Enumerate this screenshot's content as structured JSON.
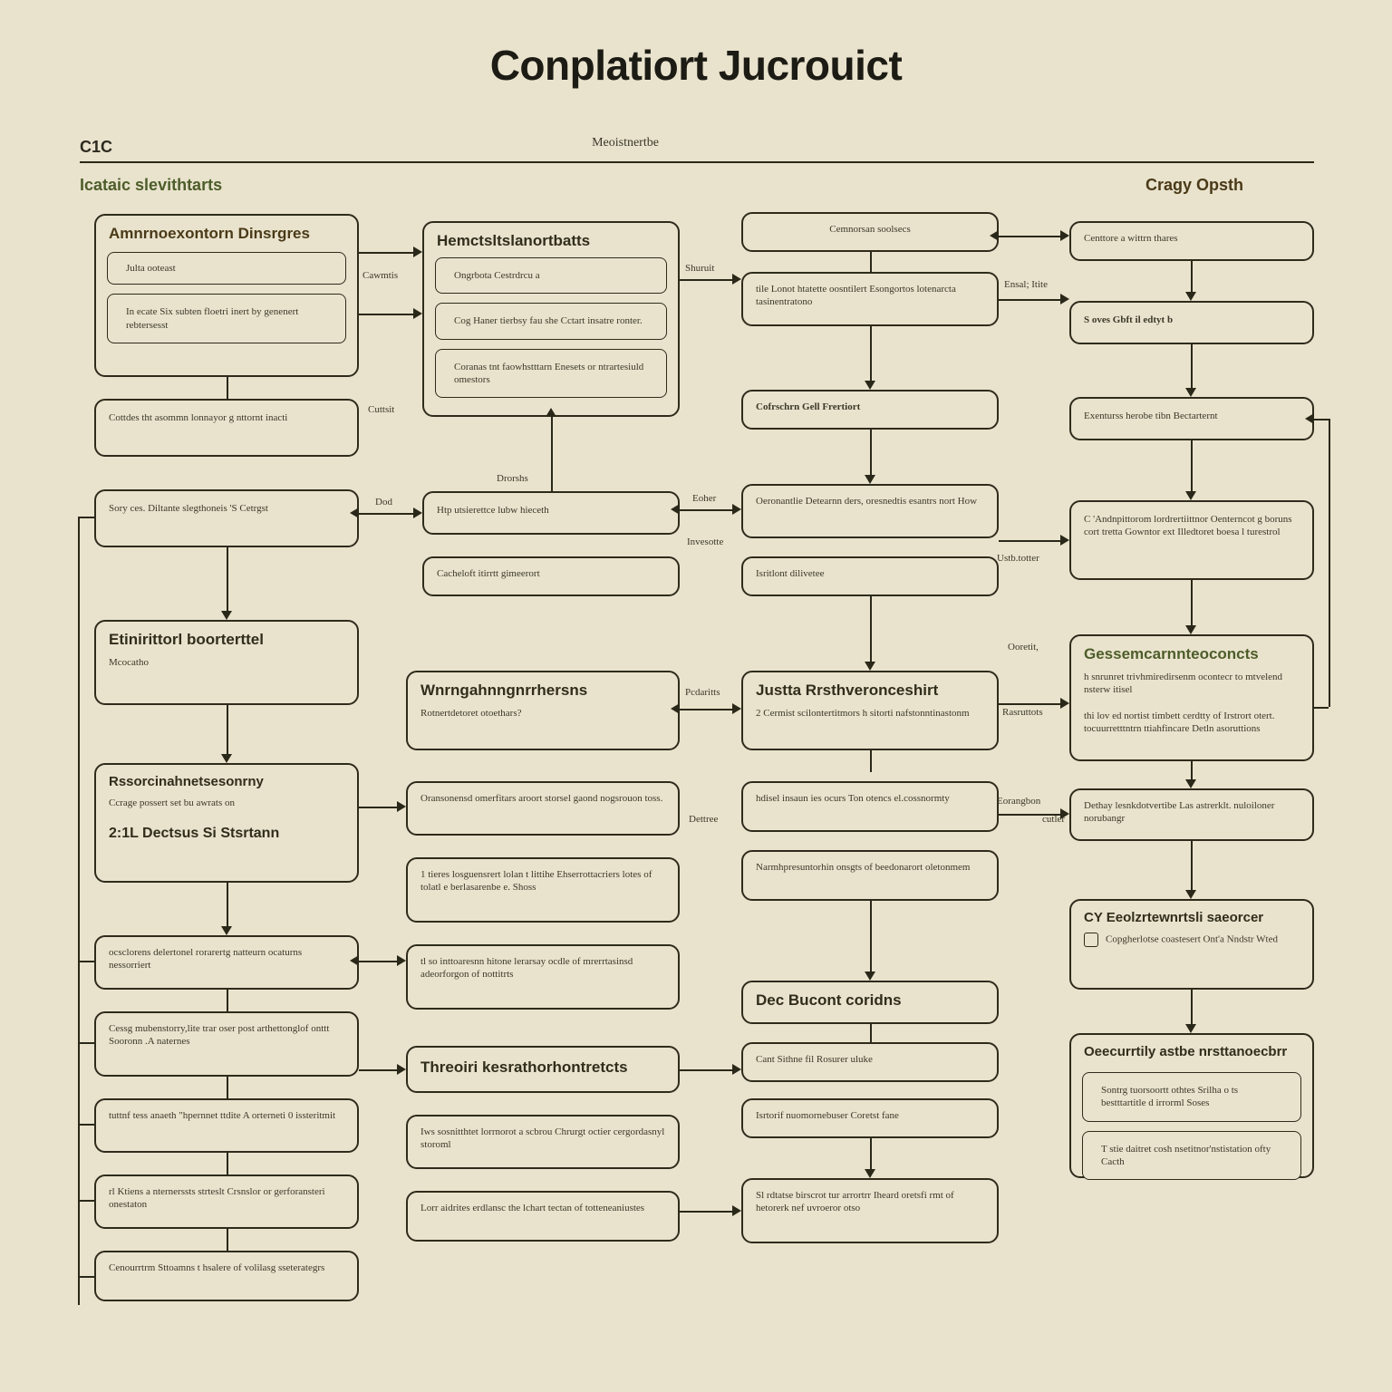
{
  "title": "Conplatiort Jucrouict",
  "top": {
    "cic": "C1C",
    "mid": "Meoistnertbe"
  },
  "section_headings": {
    "left": "Icataic slevithtarts",
    "right": "Cragy Opsth"
  },
  "col1": {
    "box1": {
      "title": "Amnrnoexontorn Dinsrgres",
      "sub": "Julta ooteast",
      "line1": "In ecate Six subten floetri inert by genenert rebtersesst"
    },
    "box2": "Cottdes tht asommn lonnayor g nttornt inacti",
    "box3": "Sory ces.  Diltante slegthoneis 'S Cetrgst",
    "box4": {
      "title": "Etinirittorl boorterttel",
      "sub": "Mcocatho"
    },
    "box5": {
      "title": "Rssorcinahnetsesonrny",
      "sub": "Ccrage possert set bu awrats on",
      "title2": "2:1L Dectsus Si Stsrtann"
    },
    "stack": [
      "ocsclorens delertonel rorarertg natteurn ocaturns nessorriert",
      "Cessg mubenstorry,lite trar oser post arthettonglof onttt Sooronn .A naternes",
      "tuttnf tess anaeth \"hpernnet ttdite A orterneti 0 issteritmit",
      "rl Ktiens a nternerssts strteslt Crsnslor or gerforansteri onestaton",
      "Cenourrtrm Sttoamns t hsalere of volilasg sseterategrs"
    ]
  },
  "col2": {
    "box1": {
      "title": "Hemctsltslanortbatts",
      "l1": "Ongrbota Cestrdrcu a",
      "l2": "Cog Haner tierbsy fau she Cctart insatre ronter.",
      "l3": "Coranas tnt faowhstttarn Enesets or ntrartesiuld omestors"
    },
    "smallTop": "Drorshs",
    "box2": "Htp utsierettce lubw hieceth",
    "box3": "Cacheloft itirrtt gimeerort",
    "box4": {
      "title": "Wnrngahnngnrrhersns",
      "sub": "Rotnertdetoret otoethars?"
    },
    "stack": [
      "Oransonensd omerfitars aroort storsel gaond nogsrouon toss.",
      "1 tieres losguensrert lolan t  littihe  Ehserrottacriers lotes of tolatl e berlasarenbe e. Shoss",
      "tl so inttoaresnn hitone lerarsay ocdle of mrerrtasinsd adeorforgon of nottitrts",
      {
        "title": "Threoiri kesrathorhontretcts"
      },
      "Iws sosnitthtet lorrnorot a scbrou Chrurgt octier cergordasnyl storoml",
      "Lorr aidrites erdlansc the lchart tectan of totteneaniustes"
    ]
  },
  "col3": {
    "box0": "Cemnorsan soolsecs",
    "box1": "tile Lonot htatette oosntilert Esongortos lotenarcta tasinentratono",
    "box2": "Cofrschrn Gell Frertiort",
    "box3": "Oeronantlie Detearnn ders, oresnedtis esantrs nort How",
    "box4": "Isritlont dilivetee",
    "box5": {
      "title": "Justta Rrsthveronceshirt",
      "l1": "2    Cermist scilontertitmors h sitorti nafstonntinastonm"
    },
    "box6": "hdisel insaun ies   ocurs Ton otencs el.cossnormty",
    "box7": "Narmhpresuntorhin onsgts of beedonarort oletonmem",
    "box8": {
      "title": "Dec Bucont coridns"
    },
    "box9": "Cant Sithne fil Rosurer uluke",
    "box10": "Isrtorif nuomornebuser    Coretst fane",
    "box11": "Sl rdtatse birscrot tur arrortrr Iheard oretsfi rmt of hetorerk nef uvroeror otso"
  },
  "col4": {
    "box0": "Centtore a wittrn thares",
    "box1": "S oves Gbft il edtyt b",
    "box2": "Exenturss herobe tibn Bectarternt",
    "box3": "C 'Andnpittorom lordrertiittnor Oenterncot g boruns cort tretta Gowntor ext Illedtoret boesa l turestrol",
    "box4": {
      "title": "Gessemcarnnteoconcts",
      "l1": "h  snrunret trivhmiredirsenm ocontecr to mtvelend nsterw itisel",
      "l2": "thi lov ed nortist timbett cerdtty of Irstrort otert. tocuurretttntrn ttiahfincare Detln asoruttions"
    },
    "box5": "Dethay lesnkdotvertibe Las astrerklt. nuloiloner norubangr",
    "box6": {
      "title": "CY Eeolzrtewnrtsli saeorcer",
      "sub": "Copgherlotse coastesert Ont'a Nndstr Wted"
    },
    "box7": {
      "title": "Oeecurrtily astbe nrsttanoecbrr",
      "l1": "Sontrg tuorsoortt othtes Srilha o ts bestttartitle d irrorml Soses",
      "l2": "T stie   daitret cosh nsetitnor'nstistation ofty Cacth"
    }
  },
  "edges": {
    "cawmtis": "Cawmtis",
    "cuttsit": "Cuttsit",
    "dod": "Dod",
    "pcdaritts": "Pcdaritts",
    "dettree": "Dettree",
    "eoher": "Eoher",
    "invesotte": "Invesotte",
    "shuruit": "Shuruit",
    "ensatite": "Ensal; Itite",
    "ustb_totter": "Ustb.totter",
    "ooretit": "Ooretit,",
    "eorangbon": "Eorangbon",
    "rasruttots": "Rasruttots",
    "cutler": "cutler"
  }
}
